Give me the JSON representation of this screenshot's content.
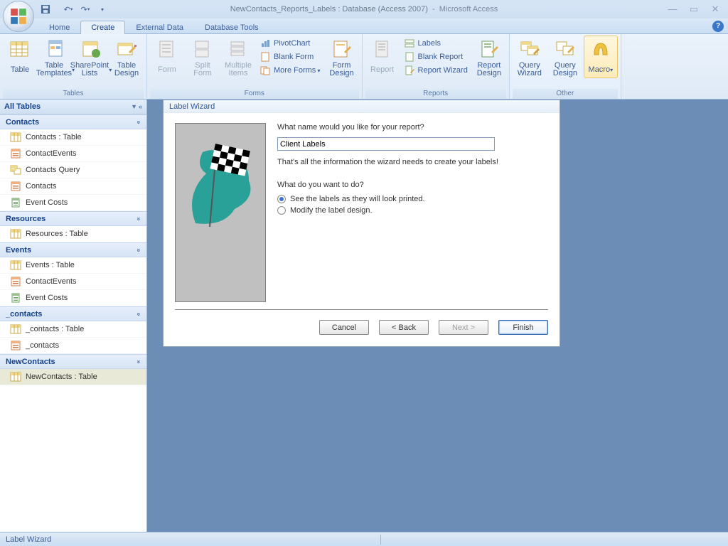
{
  "title": {
    "doc": "NewContacts_Reports_Labels : Database (Access 2007)",
    "app": "Microsoft Access"
  },
  "tabs": [
    "Home",
    "Create",
    "External Data",
    "Database Tools"
  ],
  "active_tab": "Create",
  "ribbon": {
    "tables": {
      "label": "Tables",
      "table": "Table",
      "templates": "Table Templates",
      "sharepoint": "SharePoint Lists",
      "design": "Table Design"
    },
    "forms": {
      "label": "Forms",
      "form": "Form",
      "split": "Split Form",
      "multi": "Multiple Items",
      "formdesign": "Form Design",
      "pivot": "PivotChart",
      "blank": "Blank Form",
      "more": "More Forms"
    },
    "reports": {
      "label": "Reports",
      "report": "Report",
      "reportdesign": "Report Design",
      "labels": "Labels",
      "blank": "Blank Report",
      "wizard": "Report Wizard"
    },
    "other": {
      "label": "Other",
      "qwizard": "Query Wizard",
      "qdesign": "Query Design",
      "macro": "Macro"
    }
  },
  "nav": {
    "header": "All Tables",
    "groups": [
      {
        "name": "Contacts",
        "items": [
          {
            "icon": "table",
            "label": "Contacts : Table"
          },
          {
            "icon": "form",
            "label": "ContactEvents"
          },
          {
            "icon": "query",
            "label": "Contacts Query"
          },
          {
            "icon": "form",
            "label": "Contacts"
          },
          {
            "icon": "report",
            "label": "Event Costs"
          }
        ]
      },
      {
        "name": "Resources",
        "items": [
          {
            "icon": "table",
            "label": "Resources : Table"
          }
        ]
      },
      {
        "name": "Events",
        "items": [
          {
            "icon": "table",
            "label": "Events : Table"
          },
          {
            "icon": "form",
            "label": "ContactEvents"
          },
          {
            "icon": "report",
            "label": "Event Costs"
          }
        ]
      },
      {
        "name": "_contacts",
        "items": [
          {
            "icon": "table",
            "label": "_contacts : Table"
          },
          {
            "icon": "form",
            "label": "_contacts"
          }
        ]
      },
      {
        "name": "NewContacts",
        "items": [
          {
            "icon": "table",
            "label": "NewContacts : Table",
            "sel": true
          }
        ]
      }
    ]
  },
  "wizard": {
    "title": "Label Wizard",
    "q1": "What name would you like for your report?",
    "value": "Client Labels",
    "info": "That's all the information the wizard needs to create your labels!",
    "q2": "What do you want to do?",
    "opt1": "See the labels as they will look printed.",
    "opt2": "Modify the label design.",
    "btn_cancel": "Cancel",
    "btn_back": "< Back",
    "btn_next": "Next >",
    "btn_finish": "Finish"
  },
  "status": "Label Wizard"
}
